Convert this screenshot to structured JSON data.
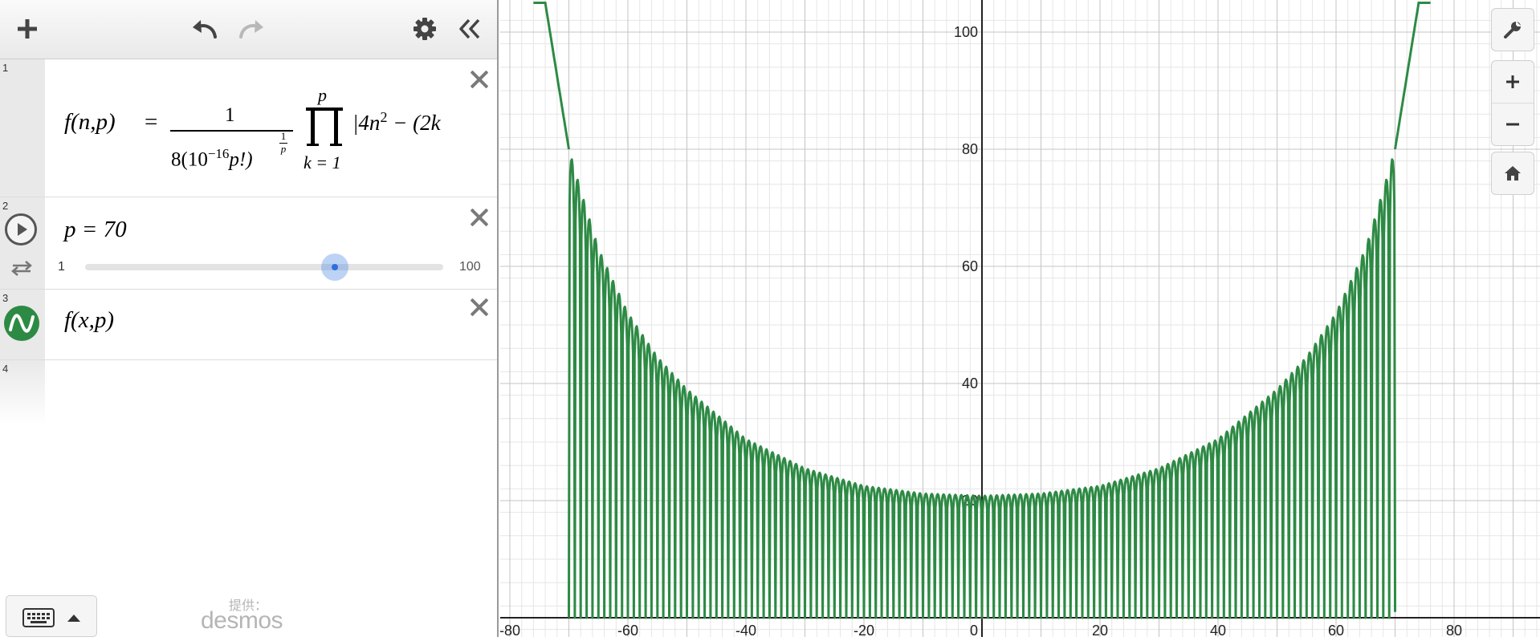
{
  "toolbar": {
    "add_icon": "plus-icon",
    "undo_icon": "undo-icon",
    "redo_icon": "redo-icon",
    "settings_icon": "gear-icon",
    "collapse_icon": "double-chevron-left-icon"
  },
  "expressions": [
    {
      "number": "1",
      "lhs": "f(n,p)",
      "equals": "=",
      "numerator": "1",
      "denominator_base": "8(10",
      "denominator_exp": "−16",
      "denominator_tail": "p!)",
      "root_exp_num": "1",
      "root_exp_den": "p",
      "product_upper": "p",
      "product_lower": "k = 1",
      "body_visible": "|4n",
      "body_exp": "2",
      "body_tail": " − (2k"
    },
    {
      "number": "2",
      "text": "p = 70",
      "slider_min": "1",
      "slider_max": "100",
      "slider_value": 70
    },
    {
      "number": "3",
      "text": "f(x,p)",
      "color": "#2d8a44"
    },
    {
      "number": "4",
      "text": ""
    }
  ],
  "keyboard": {
    "icon": "keyboard-icon",
    "toggle_icon": "triangle-up-icon"
  },
  "branding": {
    "provided_by": "提供：",
    "brand": "desmos"
  },
  "graph": {
    "x_ticks": [
      "-80",
      "-60",
      "-40",
      "-20",
      "0",
      "20",
      "40",
      "60",
      "80"
    ],
    "y_ticks": [
      "20",
      "40",
      "60",
      "80",
      "100"
    ],
    "curve_color": "#2d8a44",
    "controls": {
      "settings_icon": "wrench-icon",
      "zoom_in_icon": "plus-icon",
      "zoom_out_icon": "minus-icon",
      "home_icon": "home-icon"
    }
  },
  "chart_data": {
    "type": "line",
    "xlim": [
      -82,
      95
    ],
    "ylim": [
      -2,
      105
    ],
    "x_ticks": [
      -80,
      -60,
      -40,
      -20,
      0,
      20,
      40,
      60,
      80
    ],
    "y_ticks": [
      20,
      40,
      60,
      80,
      100
    ],
    "grid": true,
    "series": [
      {
        "color": "#2d8a44",
        "envelope": {
          "x": [
            -74,
            -70,
            -68,
            -65,
            -60,
            -55,
            -50,
            -40,
            -30,
            -20,
            -10,
            0,
            10,
            20,
            30,
            40,
            50,
            55,
            60,
            65,
            68,
            70,
            74
          ],
          "y": [
            105,
            80,
            73,
            63,
            52,
            44.5,
            39,
            30.5,
            25.5,
            22.5,
            21.2,
            20.8,
            21.2,
            22.5,
            25.5,
            30.5,
            39,
            44.5,
            52,
            63,
            73,
            80,
            105
          ]
        },
        "zeros_between": [
          -70,
          70
        ],
        "zero_count": 140
      }
    ]
  }
}
